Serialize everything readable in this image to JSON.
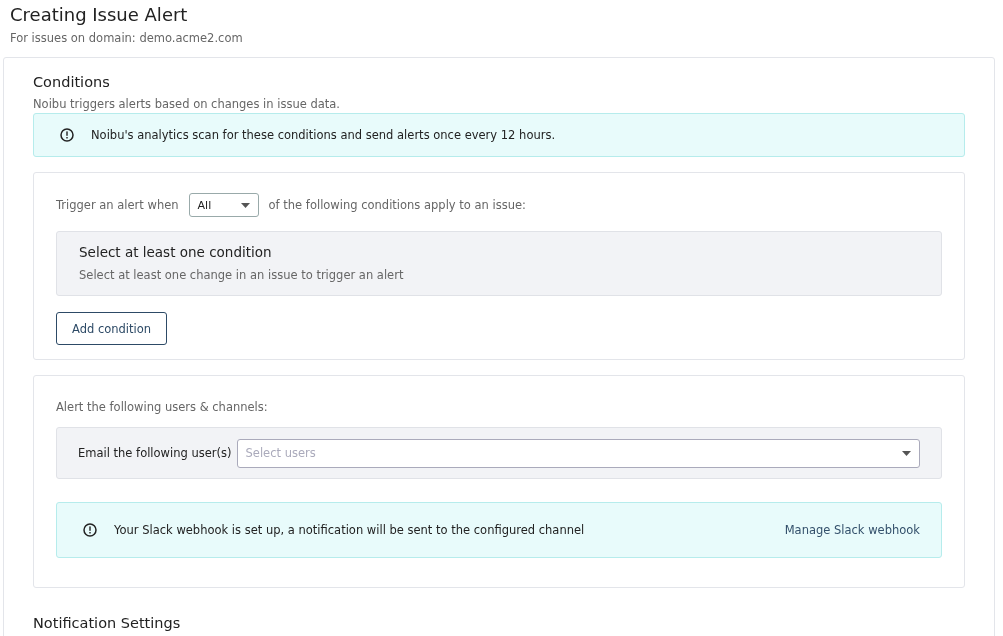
{
  "header": {
    "title": "Creating Issue Alert",
    "subtitle": "For issues on domain: demo.acme2.com"
  },
  "conditions": {
    "title": "Conditions",
    "description": "Noibu triggers alerts based on changes in issue data.",
    "notice": "Noibu's analytics scan for these conditions and send alerts once every 12 hours.",
    "trigger": {
      "prefix": "Trigger an alert when",
      "match_value": "All",
      "suffix": "of the following conditions apply to an issue:"
    },
    "empty_state": {
      "title": "Select at least one condition",
      "description": "Select at least one change in an issue to trigger an alert"
    },
    "add_button": "Add condition"
  },
  "recipients": {
    "title": "Alert the following users & channels:",
    "email_label": "Email the following user(s)",
    "email_placeholder": "Select users",
    "slack_notice": "Your Slack webhook is set up, a notification will be sent to the configured channel",
    "slack_link": "Manage Slack webhook"
  },
  "notification_settings": {
    "title": "Notification Settings"
  }
}
